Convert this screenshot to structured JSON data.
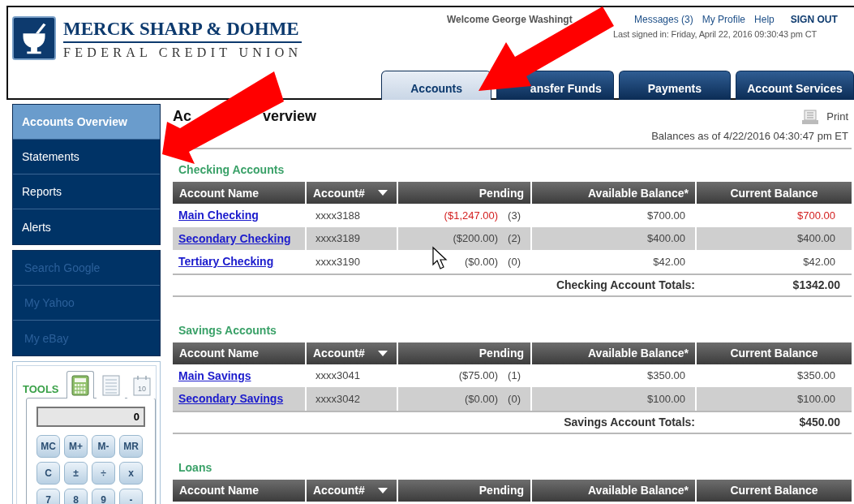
{
  "logo": {
    "name": "MERCK SHARP & DOHME",
    "subtitle": "FEDERAL CREDIT UNION"
  },
  "header": {
    "welcome": "Welcome George Washingt",
    "links": [
      {
        "label": "Messages (3)",
        "strong": false
      },
      {
        "label": "My Profile",
        "strong": false
      },
      {
        "label": "Help",
        "strong": false
      },
      {
        "label": "SIGN OUT",
        "strong": true
      }
    ],
    "last_signed_in": "Last signed in: Friday, April 22, 2016 09:30:43 pm CT"
  },
  "tabs": [
    {
      "label": "Accounts",
      "selected": true
    },
    {
      "label": "ansfer Funds",
      "selected": false
    },
    {
      "label": "Payments",
      "selected": false
    },
    {
      "label": "Account Services",
      "selected": false
    }
  ],
  "sidebar": {
    "groups": [
      {
        "items": [
          {
            "label": "Accounts Overview",
            "selected": true,
            "disabled": false
          },
          {
            "label": "Statements",
            "selected": false,
            "disabled": false
          },
          {
            "label": "Reports",
            "selected": false,
            "disabled": false
          },
          {
            "label": "Alerts",
            "selected": false,
            "disabled": false
          }
        ]
      },
      {
        "items": [
          {
            "label": "Search Google",
            "selected": false,
            "disabled": true
          },
          {
            "label": "My Yahoo",
            "selected": false,
            "disabled": true
          },
          {
            "label": "My eBay",
            "selected": false,
            "disabled": true
          }
        ]
      }
    ]
  },
  "tools": {
    "title": "TOOLS",
    "tabs": [
      {
        "kind": "calculator",
        "selected": true
      },
      {
        "kind": "notes",
        "selected": false
      },
      {
        "kind": "calendar",
        "selected": false,
        "day": "10"
      }
    ],
    "display": "0",
    "keys": [
      [
        "MC",
        "M+",
        "M-",
        "MR"
      ],
      [
        "C",
        "±",
        "÷",
        "x"
      ],
      [
        "7",
        "8",
        "9",
        "-"
      ]
    ]
  },
  "page": {
    "title_parts": [
      "Ac",
      "verview"
    ],
    "print": "Print",
    "balances_as_of": "Balances as of 4/22/2016 04:30:47 pm ET"
  },
  "sections": [
    {
      "title": "Checking Accounts",
      "columns": [
        {
          "label": "Account Name",
          "sortable": false
        },
        {
          "label": "Account#",
          "sortable": true
        },
        {
          "label": "Pending",
          "sortable": false
        },
        {
          "label": "Available Balance*",
          "sortable": false
        },
        {
          "label": "Current Balance",
          "sortable": false
        }
      ],
      "rows": [
        {
          "name": "Main Checking",
          "account": "xxxx3188",
          "pending": "($1,247.00)",
          "pending_count": "(3)",
          "available": "$700.00",
          "current": "$700.00",
          "pending_alert": true,
          "current_alert": true
        },
        {
          "name": "Secondary Checking",
          "account": "xxxx3189",
          "pending": "($200.00)",
          "pending_count": "(2)",
          "available": "$400.00",
          "current": "$400.00",
          "pending_alert": false,
          "current_alert": false
        },
        {
          "name": "Tertiary Checking",
          "account": "xxxx3190",
          "pending": "($0.00)",
          "pending_count": "(0)",
          "available": "$42.00",
          "current": "$42.00",
          "pending_alert": false,
          "current_alert": false
        }
      ],
      "totals": {
        "label": "Checking Account Totals:",
        "value": "$1342.00"
      }
    },
    {
      "title": "Savings Accounts",
      "columns": [
        {
          "label": "Account Name",
          "sortable": false
        },
        {
          "label": "Account#",
          "sortable": true
        },
        {
          "label": "Pending",
          "sortable": false
        },
        {
          "label": "Available Balance*",
          "sortable": false
        },
        {
          "label": "Current Balance",
          "sortable": false
        }
      ],
      "rows": [
        {
          "name": "Main Savings",
          "account": "xxxx3041",
          "pending": "($75.00)",
          "pending_count": "(1)",
          "available": "$350.00",
          "current": "$350.00",
          "pending_alert": false,
          "current_alert": false
        },
        {
          "name": "Secondary Savings",
          "account": "xxxx3042",
          "pending": "($0.00)",
          "pending_count": "(0)",
          "available": "$100.00",
          "current": "$100.00",
          "pending_alert": false,
          "current_alert": false
        }
      ],
      "totals": {
        "label": "Savings Account Totals:",
        "value": "$450.00"
      }
    },
    {
      "title": "Loans",
      "columns": [
        {
          "label": "Account Name",
          "sortable": false
        },
        {
          "label": "Account#",
          "sortable": true
        },
        {
          "label": "Pending",
          "sortable": false
        },
        {
          "label": "Available Balance*",
          "sortable": false
        },
        {
          "label": "Current Balance",
          "sortable": false
        }
      ]
    }
  ]
}
